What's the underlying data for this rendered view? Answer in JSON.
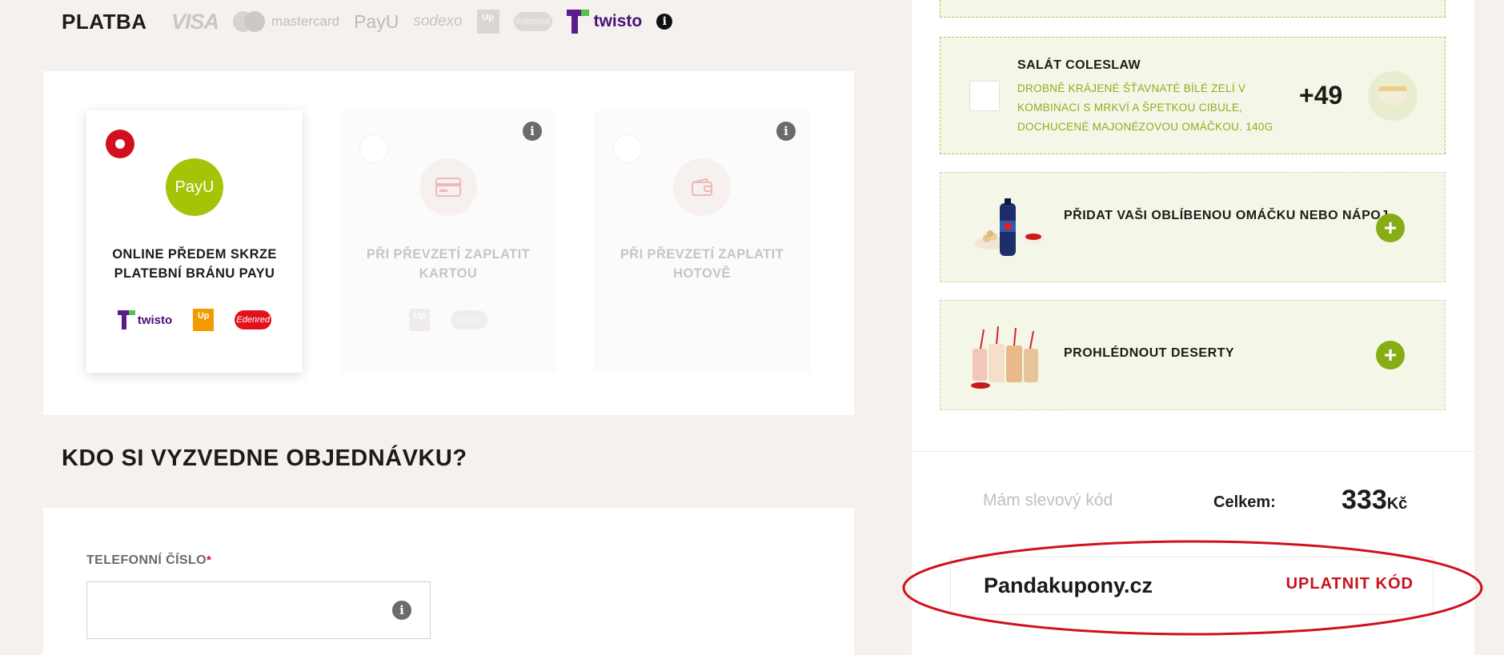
{
  "payment": {
    "title": "PLATBA",
    "brand_logos": {
      "visa": "VISA",
      "mastercard": "mastercard",
      "payu": "PayU",
      "sodexo": "sodexo",
      "up": "Up",
      "edenred": "Edenred",
      "twisto": "twisto"
    },
    "methods": [
      {
        "title": "ONLINE PŘEDEM SKRZE PLATEBNÍ BRÁNU PAYU",
        "icon": "payu-icon",
        "selected": true,
        "logo_text": "PayU",
        "sub_logos": [
          "twisto",
          "Up",
          "Edenred"
        ]
      },
      {
        "title": "PŘI PŘEVZETÍ ZAPLATIT KARTOU",
        "icon": "credit-card-icon",
        "selected": false,
        "sub_logos": [
          "Up",
          "sodexo"
        ]
      },
      {
        "title": "PŘI PŘEVZETÍ ZAPLATIT HOTOVĚ",
        "icon": "wallet-icon",
        "selected": false
      }
    ]
  },
  "pickup": {
    "heading": "KDO SI VYZVEDNE OBJEDNÁVKU?",
    "phone_label": "TELEFONNÍ ČÍSLO",
    "required_mark": "*",
    "phone_value": ""
  },
  "addons": {
    "coleslaw": {
      "name": "SALÁT COLESLAW",
      "description": "DROBNĚ KRÁJENÉ ŠŤAVNATÉ BÍLÉ ZELÍ V KOMBINACI S MRKVÍ A ŠPETKOU CIBULE, DOCHUCENÉ MAJONÉZOVOU OMÁČKOU. 140G",
      "price": "+49",
      "checked": false
    },
    "sauce": {
      "label": "PŘIDAT VAŠI OBLÍBENOU OMÁČKU NEBO NÁPOJ"
    },
    "dessert": {
      "label": "PROHLÉDNOUT DESERTY"
    },
    "plus_symbol": "+"
  },
  "summary": {
    "discount_link": "Mám slevový kód",
    "total_label": "Celkem:",
    "total_value": "333",
    "currency": "Kč"
  },
  "coupon": {
    "code_value": "Pandakupony.cz",
    "redeem_label": "UPLATNIT KÓD"
  },
  "info_glyph": "i",
  "colors": {
    "accent_red": "#d0101e",
    "addon_green": "#86ad16",
    "payu_green": "#a6c307",
    "twisto_purple": "#4b0f7a",
    "highlight_ellipse": "#d0101e"
  }
}
